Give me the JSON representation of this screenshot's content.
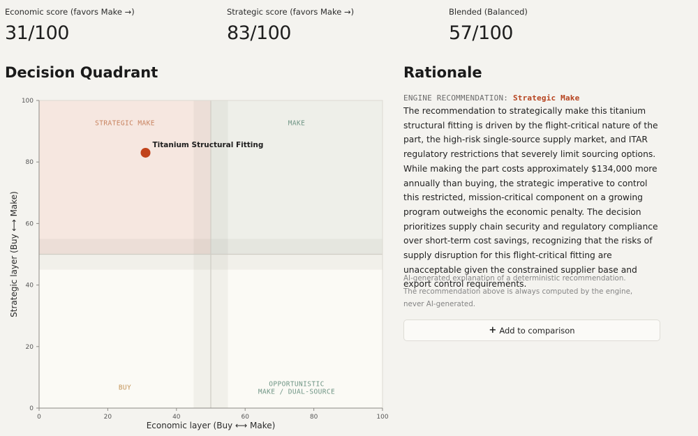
{
  "scores": [
    {
      "label": "Economic score (favors Make →)",
      "value": "31/100"
    },
    {
      "label": "Strategic score (favors Make →)",
      "value": "83/100"
    },
    {
      "label": "Blended (Balanced)",
      "value": "57/100"
    }
  ],
  "quadrant_title": "Decision Quadrant",
  "rationale": {
    "title": "Rationale",
    "engine_prefix": "ENGINE RECOMMENDATION:",
    "engine_value": "Strategic Make",
    "text": "The recommendation to strategically make this titanium structural fitting is driven by the flight-critical nature of the part, the high-risk single-source supply market, and ITAR regulatory restrictions that severely limit sourcing options. While making the part costs approximately $134,000 more annually than buying, the strategic imperative to control this restricted, mission-critical component on a growing program outweighs the economic penalty. The decision prioritizes supply chain security and regulatory compliance over short-term cost savings, recognizing that the risks of supply disruption for this flight-critical fitting are unacceptable given the constrained supplier base and export control requirements.",
    "ai_note": "AI-generated explanation of a deterministic recommendation. The recommendation above is always computed by the engine, never AI-generated."
  },
  "add_button": {
    "icon": "plus-icon",
    "label": "Add to comparison"
  },
  "chart_data": {
    "type": "scatter",
    "xlabel": "Economic layer  (Buy  ⟷  Make)",
    "ylabel": "Strategic layer  (Buy  ⟷  Make)",
    "xlim": [
      0,
      100
    ],
    "ylim": [
      0,
      100
    ],
    "xticks": [
      0,
      20,
      40,
      60,
      80,
      100
    ],
    "yticks": [
      0,
      20,
      40,
      60,
      80,
      100
    ],
    "threshold": 50,
    "uncertainty_band": [
      45,
      55
    ],
    "quadrants": [
      {
        "label": "STRATEGIC MAKE",
        "color": "#c8835f"
      },
      {
        "label": "MAKE",
        "color": "#6f9585"
      },
      {
        "label": "BUY",
        "color": "#c49458"
      },
      {
        "label": "OPPORTUNISTIC\nMAKE / DUAL-SOURCE",
        "color": "#6f9585"
      }
    ],
    "quadrant_fills": {
      "strategic_make": "#f6e7e0",
      "make": "#eeefe9",
      "buy": "#fbfaf5",
      "opportunistic": "#fbfaf5"
    },
    "points": [
      {
        "x": 31,
        "y": 83,
        "label": "Titanium Structural Fitting",
        "color": "#c1431b"
      }
    ],
    "grid": false,
    "legend": "none"
  }
}
